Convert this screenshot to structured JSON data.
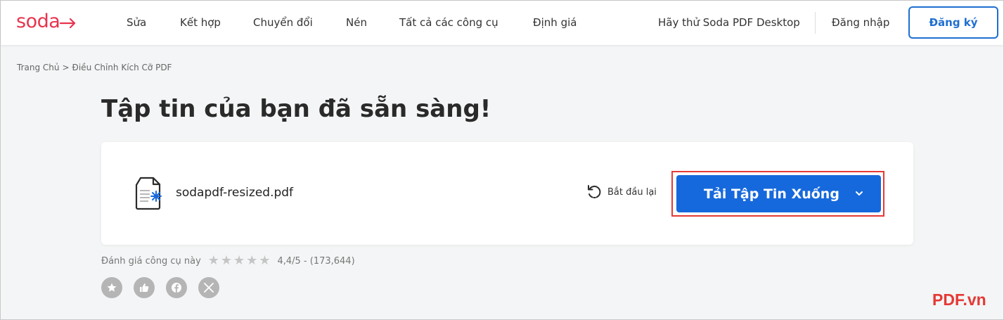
{
  "header": {
    "logo": "soda",
    "nav": [
      "Sửa",
      "Kết hợp",
      "Chuyển đổi",
      "Nén",
      "Tất cả các công cụ",
      "Định giá"
    ],
    "try_desktop": "Hãy thử Soda PDF Desktop",
    "login": "Đăng nhập",
    "signup": "Đăng ký"
  },
  "breadcrumb": {
    "home": "Trang Chủ",
    "separator": ">",
    "current": "Điều Chỉnh Kích Cỡ PDF"
  },
  "page_title": "Tập tin của bạn đã sẵn sàng!",
  "file": {
    "name": "sodapdf-resized.pdf",
    "restart_label": "Bắt đầu lại",
    "download_label": "Tải Tập Tin Xuống"
  },
  "rating": {
    "label": "Đánh giá công cụ này",
    "score": "4,4/5 - (173,644)",
    "stars": 5
  },
  "social": [
    "star-icon",
    "thumbs-up-icon",
    "facebook-icon",
    "x-icon"
  ],
  "watermark": "PDF.vn",
  "colors": {
    "brand": "#e8344e",
    "primary": "#1669dc",
    "highlight": "#e53935"
  }
}
